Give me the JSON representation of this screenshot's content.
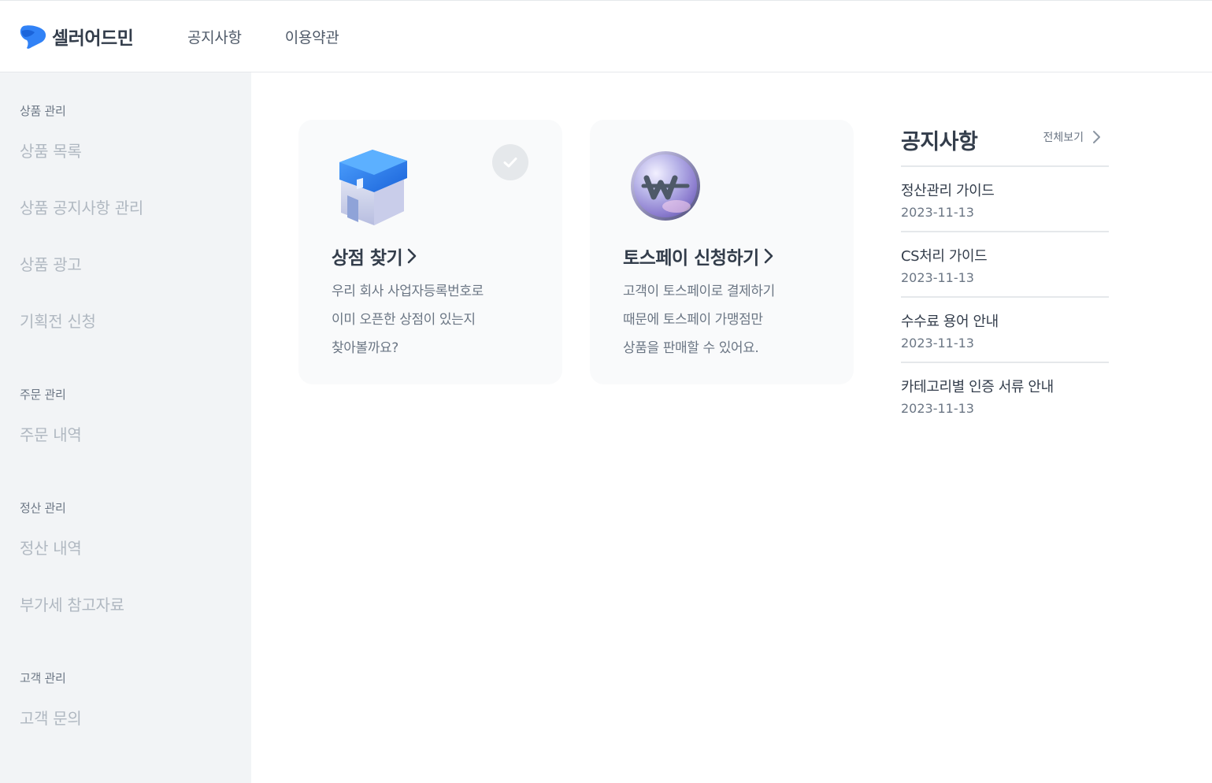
{
  "header": {
    "logo_text": "셀러어드민",
    "nav": [
      "공지사항",
      "이용약관"
    ],
    "brand_color": "#3182f6"
  },
  "sidebar": {
    "groups": [
      {
        "title": "상품 관리",
        "items": [
          "상품 목록",
          "상품 공지사항 관리",
          "상품 광고",
          "기획전 신청"
        ]
      },
      {
        "title": "주문 관리",
        "items": [
          "주문 내역"
        ]
      },
      {
        "title": "정산 관리",
        "items": [
          "정산 내역",
          "부가세 참고자료"
        ]
      },
      {
        "title": "고객 관리",
        "items": [
          "고객 문의"
        ]
      }
    ]
  },
  "cards": [
    {
      "title": "상점 찾기",
      "icon": "store-box-icon",
      "completed": true,
      "desc": [
        "우리 회사 사업자등록번호로",
        "이미 오픈한 상점이 있는지",
        "찾아볼까요?"
      ]
    },
    {
      "title": "토스페이 신청하기",
      "icon": "won-coin-icon",
      "completed": false,
      "desc": [
        "고객이 토스페이로 결제하기",
        "때문에 토스페이 가맹점만",
        "상품을 판매할 수 있어요."
      ]
    }
  ],
  "notices": {
    "title": "공지사항",
    "view_all": "전체보기",
    "items": [
      {
        "title": "정산관리 가이드",
        "date": "2023-11-13"
      },
      {
        "title": "CS처리 가이드",
        "date": "2023-11-13"
      },
      {
        "title": "수수료 용어 안내",
        "date": "2023-11-13"
      },
      {
        "title": "카테고리별 인증 서류 안내",
        "date": "2023-11-13"
      }
    ]
  }
}
